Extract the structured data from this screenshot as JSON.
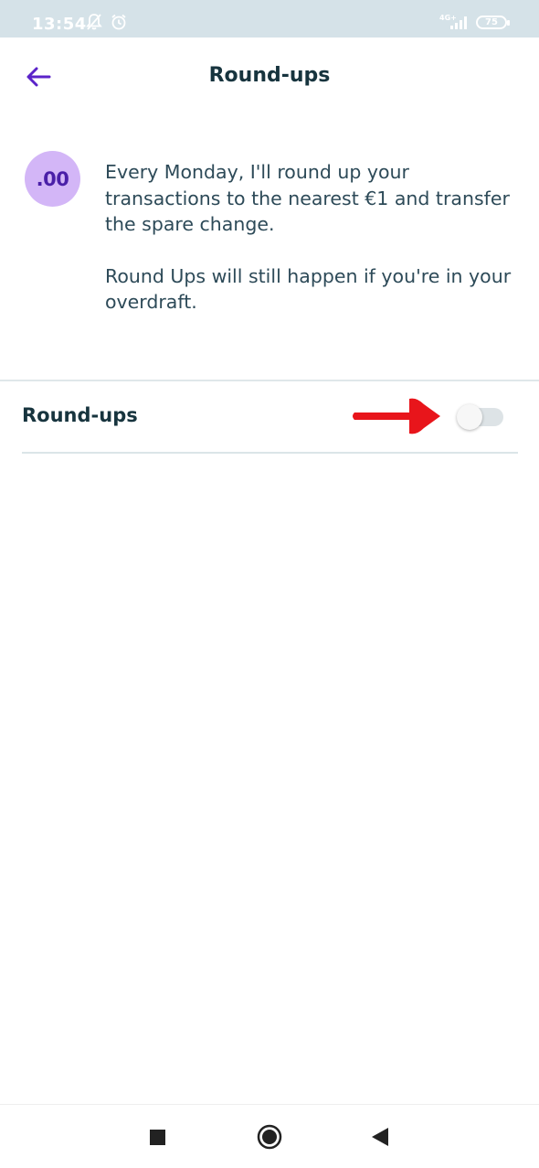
{
  "status_bar": {
    "time": "13:54",
    "network": "4G+",
    "battery": "75",
    "icons": [
      "notifications-off-icon",
      "alarm-icon",
      "signal-icon",
      "battery-icon"
    ]
  },
  "header": {
    "title": "Round-ups",
    "back_icon": "arrow-left-icon"
  },
  "intro": {
    "badge_text": ".00",
    "paragraph_1": "Every Monday, I'll round up your transactions to the nearest €1 and transfer the spare change.",
    "paragraph_2": "Round Ups will still happen if you're in your overdraft."
  },
  "setting": {
    "label": "Round-ups",
    "enabled": false
  },
  "annotation": {
    "icon": "red-arrow-icon",
    "color": "#e8151b"
  },
  "nav_bar": {
    "buttons": [
      "recents-square-icon",
      "home-circle-icon",
      "back-triangle-icon"
    ]
  },
  "colors": {
    "accent": "#5b23c9",
    "badge_bg": "#d3b6f7",
    "text_dark": "#17343e",
    "status_bar_bg": "#d5e2e8"
  }
}
